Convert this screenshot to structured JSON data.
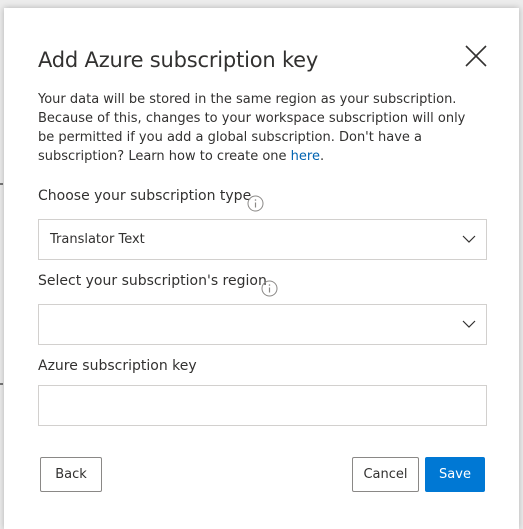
{
  "dialog": {
    "title": "Add Azure subscription key",
    "description": "Your data will be stored in the same region as your subscription. Because of this, changes to your workspace subscription will only be permitted if you add a global subscription. Don't have a subscription? Learn how to create one ",
    "description_link": "here",
    "description_end": "."
  },
  "fields": {
    "subscription_type": {
      "label": "Choose your subscription type",
      "value": "Translator Text"
    },
    "region": {
      "label": "Select your subscription's region",
      "value": ""
    },
    "key": {
      "label": "Azure subscription key",
      "value": ""
    }
  },
  "buttons": {
    "back": "Back",
    "cancel": "Cancel",
    "save": "Save"
  },
  "colors": {
    "primary": "#0078d4",
    "link": "#0063b1",
    "text": "#323130",
    "border": "#d2d0ce"
  },
  "icons": {
    "close": "close-icon",
    "info": "info-icon",
    "chevron": "chevron-down-icon"
  }
}
